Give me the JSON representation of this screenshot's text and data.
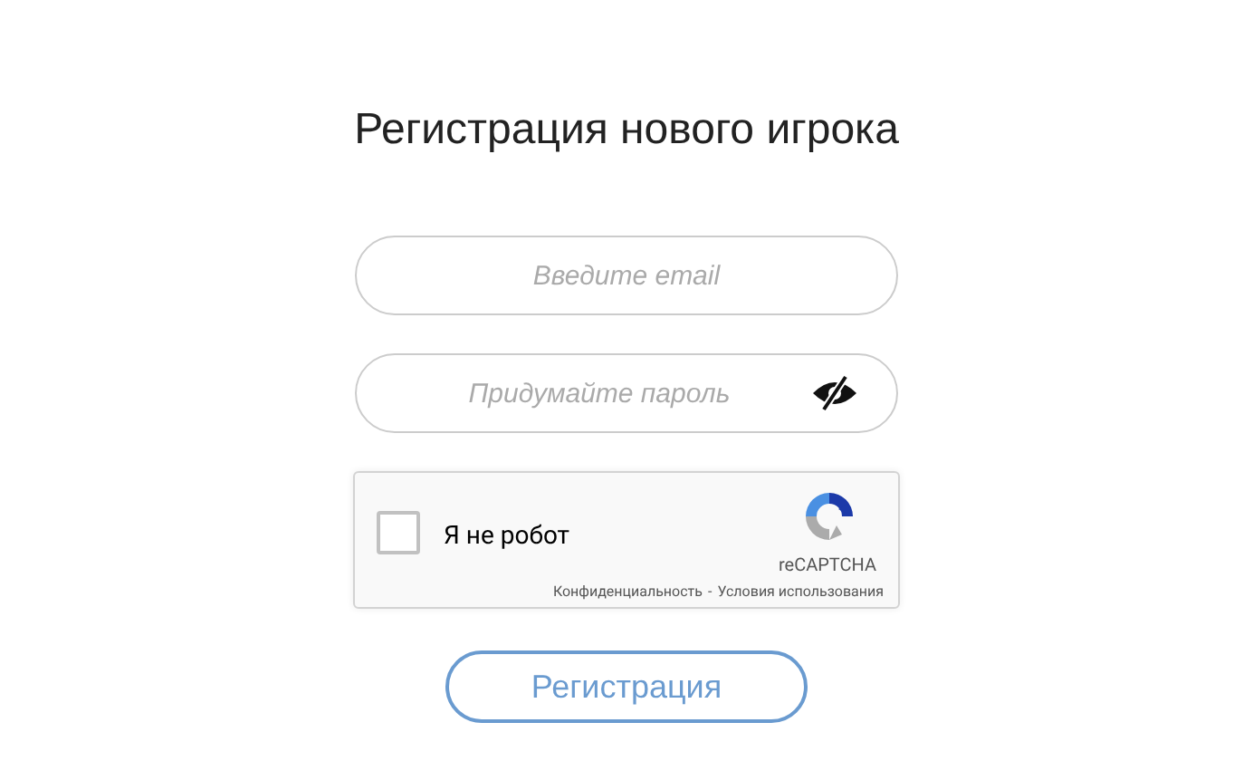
{
  "title": "Регистрация нового игрока",
  "email": {
    "placeholder": "Введите email"
  },
  "password": {
    "placeholder": "Придумайте пароль"
  },
  "captcha": {
    "label": "Я не робот",
    "checked": false,
    "brand": "reCAPTCHA",
    "privacy": "Конфиденциальность",
    "separator": "-",
    "terms": "Условия использования"
  },
  "submit": "Регистрация"
}
